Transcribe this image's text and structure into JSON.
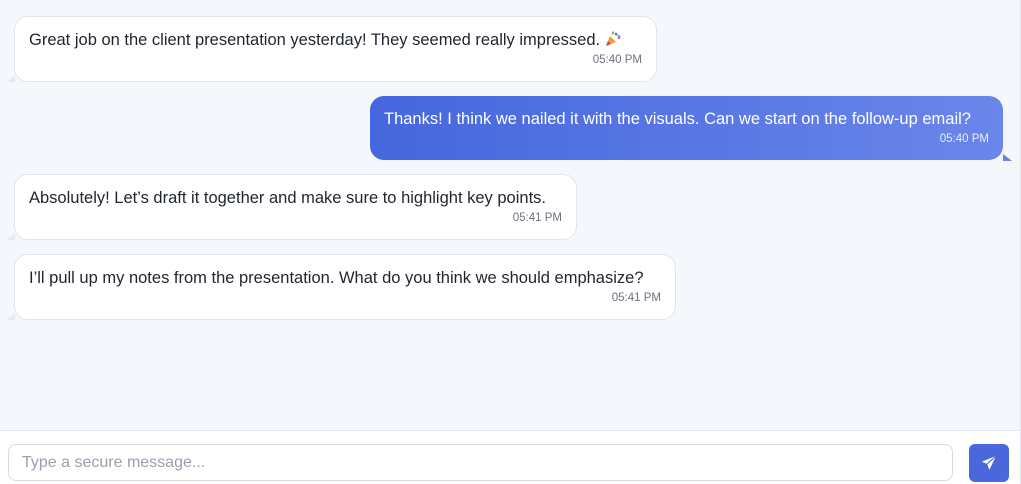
{
  "messages": [
    {
      "direction": "incoming",
      "text": "Great job on the client presentation yesterday! They seemed really impressed.",
      "emoji": "party-popper",
      "time": "05:40 PM"
    },
    {
      "direction": "outgoing",
      "text": "Thanks! I think we nailed it with the visuals. Can we start on the follow-up email?",
      "time": "05:40 PM"
    },
    {
      "direction": "incoming",
      "text": "Absolutely! Let’s draft it together and make sure to highlight key points.",
      "time": "05:41 PM"
    },
    {
      "direction": "incoming",
      "text": "I’ll pull up my notes from the presentation. What do you think we should emphasize?",
      "time": "05:41 PM"
    }
  ],
  "composer": {
    "placeholder": "Type a secure message...",
    "value": "",
    "send_icon": "paper-plane-icon"
  },
  "colors": {
    "background": "#f4f7fb",
    "incoming_bubble": "#ffffff",
    "outgoing_gradient_start": "#4567dd",
    "outgoing_gradient_end": "#6b86ea",
    "send_button": "#4a67db"
  }
}
